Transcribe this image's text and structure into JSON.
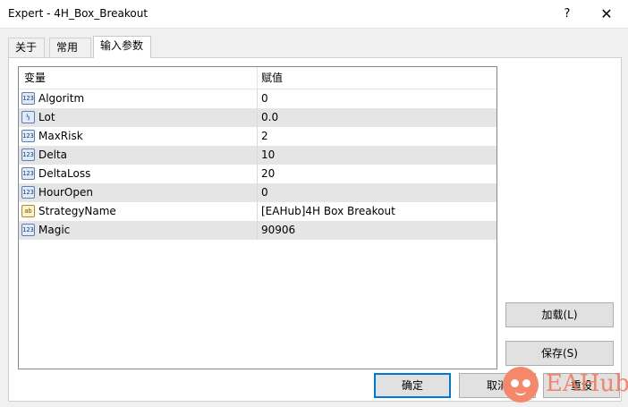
{
  "window": {
    "title": "Expert - 4H_Box_Breakout",
    "help_glyph": "?",
    "close_glyph": "✕"
  },
  "tabs": [
    {
      "label": "关于",
      "active": false
    },
    {
      "label": "常用",
      "active": false
    },
    {
      "label": "输入参数",
      "active": true
    }
  ],
  "grid": {
    "columns": [
      "变量",
      "赋值"
    ],
    "rows": [
      {
        "type": "int",
        "type_glyph": "123",
        "name": "Algoritm",
        "value": "0"
      },
      {
        "type": "double",
        "type_glyph": "½",
        "name": "Lot",
        "value": "0.0"
      },
      {
        "type": "int",
        "type_glyph": "123",
        "name": "MaxRisk",
        "value": "2"
      },
      {
        "type": "int",
        "type_glyph": "123",
        "name": "Delta",
        "value": "10"
      },
      {
        "type": "int",
        "type_glyph": "123",
        "name": "DeltaLoss",
        "value": "20"
      },
      {
        "type": "int",
        "type_glyph": "123",
        "name": "HourOpen",
        "value": "0"
      },
      {
        "type": "string",
        "type_glyph": "ab",
        "name": "StrategyName",
        "value": "[EAHub]4H Box Breakout"
      },
      {
        "type": "int",
        "type_glyph": "123",
        "name": "Magic",
        "value": "90906"
      }
    ]
  },
  "buttons": {
    "load": "加载(L)",
    "save": "保存(S)",
    "ok": "确定",
    "cancel": "取消",
    "reset": "重设"
  },
  "watermark": {
    "text": "EAHub",
    "color": "#f47a5a"
  }
}
